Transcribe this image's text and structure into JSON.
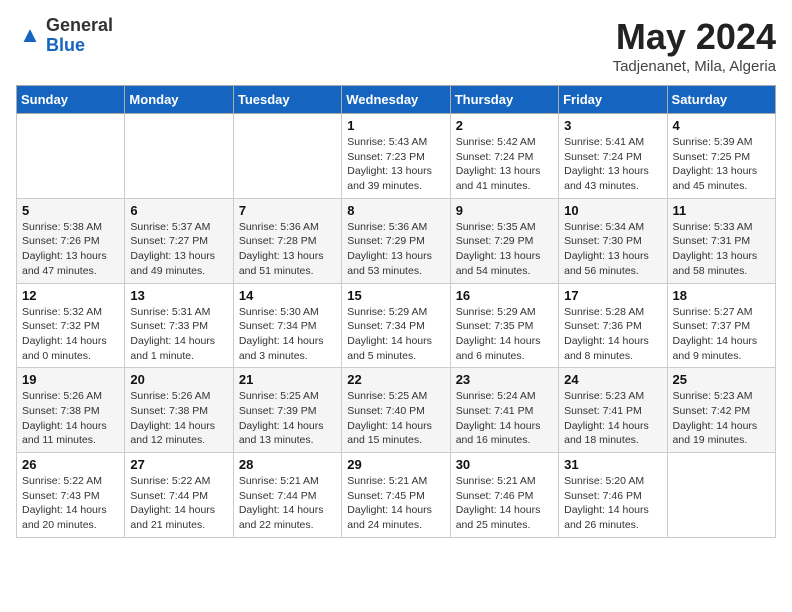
{
  "header": {
    "logo_line1": "General",
    "logo_line2": "Blue",
    "month_title": "May 2024",
    "location": "Tadjenanet, Mila, Algeria"
  },
  "weekdays": [
    "Sunday",
    "Monday",
    "Tuesday",
    "Wednesday",
    "Thursday",
    "Friday",
    "Saturday"
  ],
  "weeks": [
    [
      {
        "day": "",
        "info": ""
      },
      {
        "day": "",
        "info": ""
      },
      {
        "day": "",
        "info": ""
      },
      {
        "day": "1",
        "info": "Sunrise: 5:43 AM\nSunset: 7:23 PM\nDaylight: 13 hours\nand 39 minutes."
      },
      {
        "day": "2",
        "info": "Sunrise: 5:42 AM\nSunset: 7:24 PM\nDaylight: 13 hours\nand 41 minutes."
      },
      {
        "day": "3",
        "info": "Sunrise: 5:41 AM\nSunset: 7:24 PM\nDaylight: 13 hours\nand 43 minutes."
      },
      {
        "day": "4",
        "info": "Sunrise: 5:39 AM\nSunset: 7:25 PM\nDaylight: 13 hours\nand 45 minutes."
      }
    ],
    [
      {
        "day": "5",
        "info": "Sunrise: 5:38 AM\nSunset: 7:26 PM\nDaylight: 13 hours\nand 47 minutes."
      },
      {
        "day": "6",
        "info": "Sunrise: 5:37 AM\nSunset: 7:27 PM\nDaylight: 13 hours\nand 49 minutes."
      },
      {
        "day": "7",
        "info": "Sunrise: 5:36 AM\nSunset: 7:28 PM\nDaylight: 13 hours\nand 51 minutes."
      },
      {
        "day": "8",
        "info": "Sunrise: 5:36 AM\nSunset: 7:29 PM\nDaylight: 13 hours\nand 53 minutes."
      },
      {
        "day": "9",
        "info": "Sunrise: 5:35 AM\nSunset: 7:29 PM\nDaylight: 13 hours\nand 54 minutes."
      },
      {
        "day": "10",
        "info": "Sunrise: 5:34 AM\nSunset: 7:30 PM\nDaylight: 13 hours\nand 56 minutes."
      },
      {
        "day": "11",
        "info": "Sunrise: 5:33 AM\nSunset: 7:31 PM\nDaylight: 13 hours\nand 58 minutes."
      }
    ],
    [
      {
        "day": "12",
        "info": "Sunrise: 5:32 AM\nSunset: 7:32 PM\nDaylight: 14 hours\nand 0 minutes."
      },
      {
        "day": "13",
        "info": "Sunrise: 5:31 AM\nSunset: 7:33 PM\nDaylight: 14 hours\nand 1 minute."
      },
      {
        "day": "14",
        "info": "Sunrise: 5:30 AM\nSunset: 7:34 PM\nDaylight: 14 hours\nand 3 minutes."
      },
      {
        "day": "15",
        "info": "Sunrise: 5:29 AM\nSunset: 7:34 PM\nDaylight: 14 hours\nand 5 minutes."
      },
      {
        "day": "16",
        "info": "Sunrise: 5:29 AM\nSunset: 7:35 PM\nDaylight: 14 hours\nand 6 minutes."
      },
      {
        "day": "17",
        "info": "Sunrise: 5:28 AM\nSunset: 7:36 PM\nDaylight: 14 hours\nand 8 minutes."
      },
      {
        "day": "18",
        "info": "Sunrise: 5:27 AM\nSunset: 7:37 PM\nDaylight: 14 hours\nand 9 minutes."
      }
    ],
    [
      {
        "day": "19",
        "info": "Sunrise: 5:26 AM\nSunset: 7:38 PM\nDaylight: 14 hours\nand 11 minutes."
      },
      {
        "day": "20",
        "info": "Sunrise: 5:26 AM\nSunset: 7:38 PM\nDaylight: 14 hours\nand 12 minutes."
      },
      {
        "day": "21",
        "info": "Sunrise: 5:25 AM\nSunset: 7:39 PM\nDaylight: 14 hours\nand 13 minutes."
      },
      {
        "day": "22",
        "info": "Sunrise: 5:25 AM\nSunset: 7:40 PM\nDaylight: 14 hours\nand 15 minutes."
      },
      {
        "day": "23",
        "info": "Sunrise: 5:24 AM\nSunset: 7:41 PM\nDaylight: 14 hours\nand 16 minutes."
      },
      {
        "day": "24",
        "info": "Sunrise: 5:23 AM\nSunset: 7:41 PM\nDaylight: 14 hours\nand 18 minutes."
      },
      {
        "day": "25",
        "info": "Sunrise: 5:23 AM\nSunset: 7:42 PM\nDaylight: 14 hours\nand 19 minutes."
      }
    ],
    [
      {
        "day": "26",
        "info": "Sunrise: 5:22 AM\nSunset: 7:43 PM\nDaylight: 14 hours\nand 20 minutes."
      },
      {
        "day": "27",
        "info": "Sunrise: 5:22 AM\nSunset: 7:44 PM\nDaylight: 14 hours\nand 21 minutes."
      },
      {
        "day": "28",
        "info": "Sunrise: 5:21 AM\nSunset: 7:44 PM\nDaylight: 14 hours\nand 22 minutes."
      },
      {
        "day": "29",
        "info": "Sunrise: 5:21 AM\nSunset: 7:45 PM\nDaylight: 14 hours\nand 24 minutes."
      },
      {
        "day": "30",
        "info": "Sunrise: 5:21 AM\nSunset: 7:46 PM\nDaylight: 14 hours\nand 25 minutes."
      },
      {
        "day": "31",
        "info": "Sunrise: 5:20 AM\nSunset: 7:46 PM\nDaylight: 14 hours\nand 26 minutes."
      },
      {
        "day": "",
        "info": ""
      }
    ]
  ]
}
